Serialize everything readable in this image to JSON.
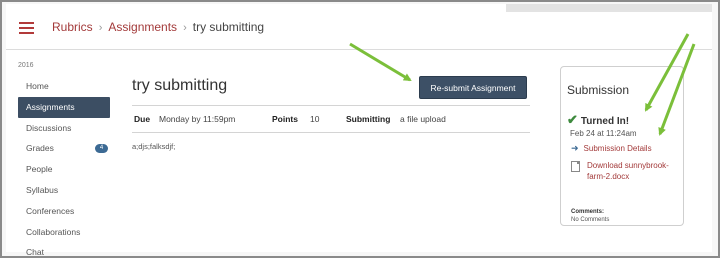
{
  "header": {
    "breadcrumb": [
      "Rubrics",
      "Assignments",
      "try submitting"
    ]
  },
  "sidebar": {
    "term": "2016",
    "items": [
      {
        "label": "Home"
      },
      {
        "label": "Assignments",
        "active": true
      },
      {
        "label": "Discussions"
      },
      {
        "label": "Grades",
        "badge": "4"
      },
      {
        "label": "People"
      },
      {
        "label": "Syllabus"
      },
      {
        "label": "Conferences"
      },
      {
        "label": "Collaborations"
      },
      {
        "label": "Chat"
      }
    ]
  },
  "assignment": {
    "title": "try submitting",
    "resubmit_label": "Re-submit Assignment",
    "due_label": "Due",
    "due_value": "Monday by 11:59pm",
    "points_label": "Points",
    "points_value": "10",
    "submitting_label": "Submitting",
    "submitting_value": "a file upload",
    "submission_text": "a;djs;falksdjf;"
  },
  "submission_panel": {
    "title": "Submission",
    "status": "Turned In!",
    "date": "Feb 24 at 11:24am",
    "details_link": "Submission Details",
    "download_link": "Download sunnybrook-farm-2.docx",
    "comments_label": "Comments:",
    "comments_value": "No Comments"
  },
  "colors": {
    "link": "#a33a3a",
    "active_nav": "#3c4e63",
    "button": "#3d5066",
    "arrow": "#7bbf3a",
    "check": "#3e8a3e"
  },
  "icons": {
    "menu": "hamburger-icon",
    "check": "check-icon",
    "details": "arrow-right-icon",
    "file": "document-icon"
  }
}
